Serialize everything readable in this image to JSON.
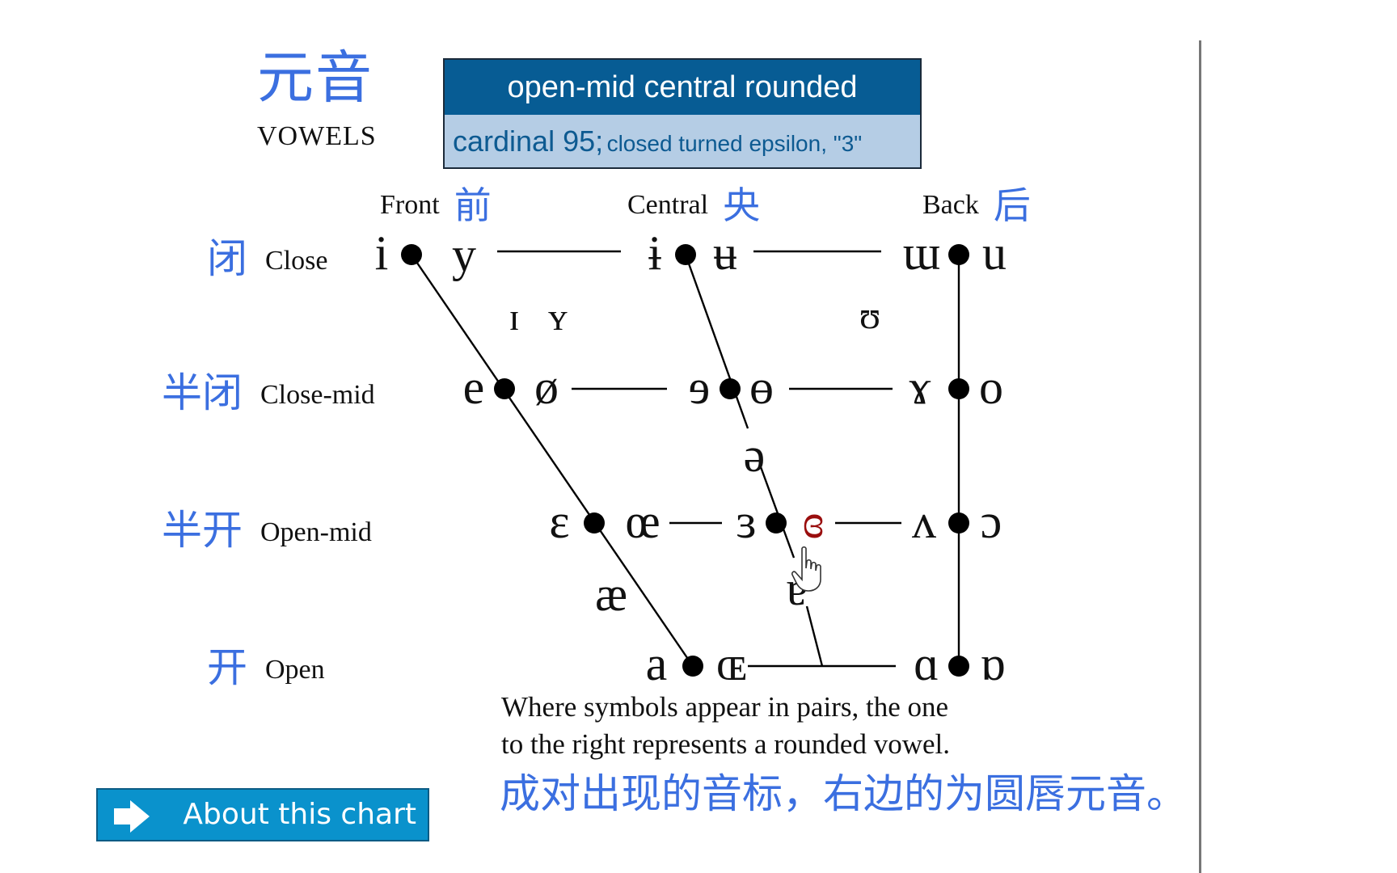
{
  "header": {
    "title_cjk": "元音",
    "title_en": "VOWELS"
  },
  "info_box": {
    "name": "open-mid central rounded",
    "cardinal": "cardinal 95;",
    "description": "closed turned epsilon, \"3\"",
    "colors": {
      "header_bg": "#075c94",
      "sub_bg": "#b5cde5",
      "sub_text": "#0d5a91"
    }
  },
  "columns": [
    {
      "en": "Front",
      "cjk": "前"
    },
    {
      "en": "Central",
      "cjk": "央"
    },
    {
      "en": "Back",
      "cjk": "后"
    }
  ],
  "rows": [
    {
      "en": "Close",
      "cjk": "闭"
    },
    {
      "en": "Close-mid",
      "cjk": "半闭"
    },
    {
      "en": "Open-mid",
      "cjk": "半开"
    },
    {
      "en": "Open",
      "cjk": "开"
    }
  ],
  "vowels": {
    "close_front": [
      "i",
      "y"
    ],
    "close_central": [
      "ɨ",
      "ʉ"
    ],
    "close_back": [
      "ɯ",
      "u"
    ],
    "near_close_front": [
      "ɪ",
      "ʏ"
    ],
    "near_close_back": "ʊ",
    "close_mid_front": [
      "e",
      "ø"
    ],
    "close_mid_central": [
      "ɘ",
      "ɵ"
    ],
    "close_mid_back": [
      "ɤ",
      "o"
    ],
    "mid_central": "ə",
    "open_mid_front": [
      "ɛ",
      "œ"
    ],
    "open_mid_central": [
      "ɜ",
      "ɞ"
    ],
    "open_mid_back": [
      "ʌ",
      "ɔ"
    ],
    "near_open_front": "æ",
    "near_open_central": "ɐ",
    "open_front": [
      "a",
      "ɶ"
    ],
    "open_back": [
      "ɑ",
      "ɒ"
    ]
  },
  "highlighted_symbol": "ɞ",
  "highlight_color": "#9a0e0e",
  "note_en_line1": "Where symbols appear in pairs, the one",
  "note_en_line2": "to the right represents a rounded vowel.",
  "note_cjk": "成对出现的音标，右边的为圆唇元音。",
  "about_button": {
    "label": "About this chart",
    "icon": "arrow-right-icon"
  },
  "accent_color": "#3b6fe0"
}
